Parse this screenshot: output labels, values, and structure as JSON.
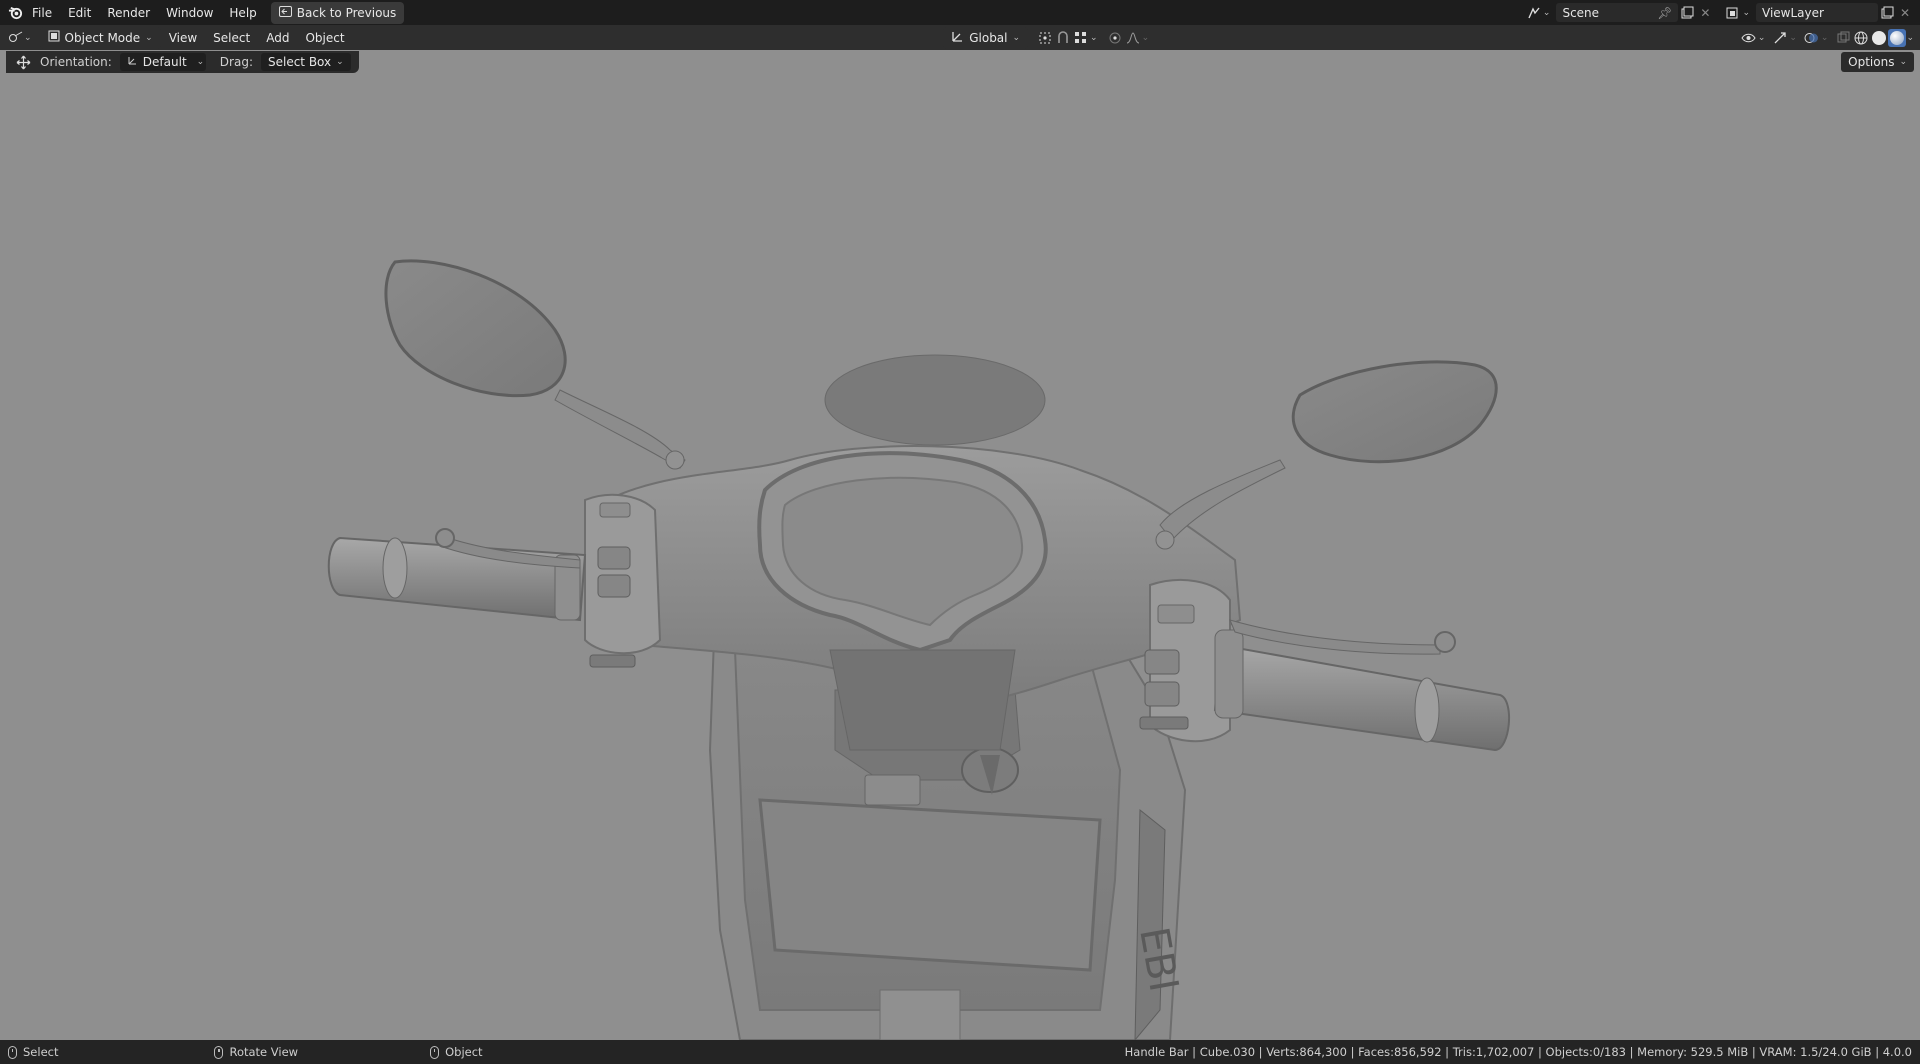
{
  "topbar": {
    "menus": [
      "File",
      "Edit",
      "Render",
      "Window",
      "Help"
    ],
    "back_button": "Back to Previous",
    "scene": "Scene",
    "view_layer": "ViewLayer"
  },
  "header": {
    "mode": "Object Mode",
    "menus": [
      "View",
      "Select",
      "Add",
      "Object"
    ],
    "transform_orientation": "Global"
  },
  "toolbar": {
    "orientation_label": "Orientation:",
    "orientation_value": "Default",
    "drag_label": "Drag:",
    "drag_value": "Select Box",
    "options": "Options"
  },
  "statusbar": {
    "select": "Select",
    "rotate": "Rotate View",
    "object": "Object",
    "stats": "Handle Bar | Cube.030 | Verts:864,300 | Faces:856,592 | Tris:1,702,007 | Objects:0/183 | Memory: 529.5 MiB | VRAM: 1.5/24.0 GiB | 4.0.0"
  },
  "viewport": {
    "subject": "scooter handlebar 3D model, solid shading",
    "background": "#8f8f8f"
  },
  "colors": {
    "topbar": "#1d1d1d",
    "header": "#2e2e2e",
    "accent": "#4772b3"
  }
}
